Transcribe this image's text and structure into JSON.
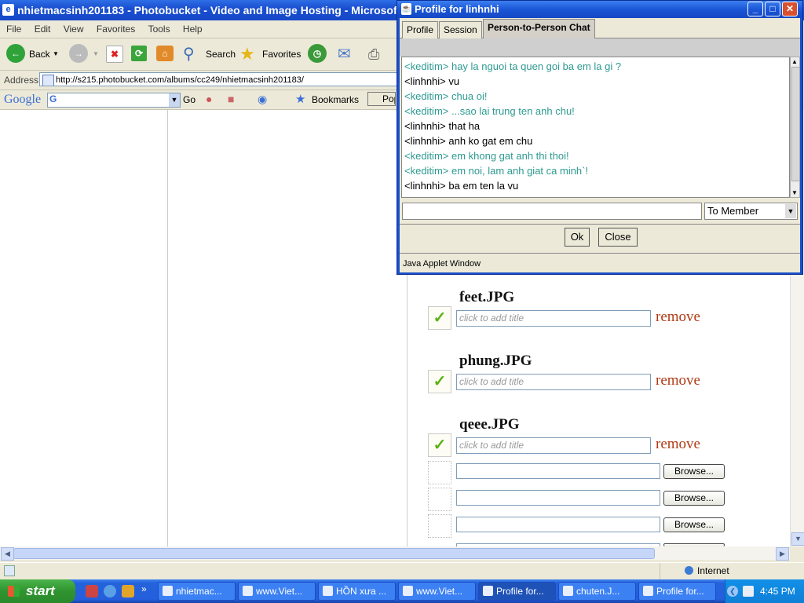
{
  "browser": {
    "title": "nhietmacsinh201183 - Photobucket - Video and Image Hosting - Microsoft Inte",
    "menu": [
      "File",
      "Edit",
      "View",
      "Favorites",
      "Tools",
      "Help"
    ],
    "toolbar": {
      "back": "Back",
      "search": "Search",
      "favorites": "Favorites"
    },
    "address_label": "Address",
    "address_url": "http://s215.photobucket.com/albums/cc249/nhietmacsinh201183/",
    "google": {
      "logo": "Google",
      "go": "Go",
      "bookmarks": "Bookmarks",
      "popups": "Pop"
    },
    "status_zone": "Internet"
  },
  "page": {
    "photos": [
      {
        "filename": "feet.JPG",
        "title_placeholder": "click to add title",
        "remove": "remove"
      },
      {
        "filename": "phung.JPG",
        "title_placeholder": "click to add title",
        "remove": "remove"
      },
      {
        "filename": "qeee.JPG",
        "title_placeholder": "click to add title",
        "remove": "remove"
      }
    ],
    "browse_label": "Browse..."
  },
  "applet": {
    "title": "Profile for linhnhi",
    "tabs": [
      "Profile",
      "Session",
      "Person-to-Person Chat"
    ],
    "active_tab": "Person-to-Person Chat",
    "chat": [
      {
        "speaker": "other",
        "text": "<keditim> hay la nguoi ta quen goi ba em la gi ?"
      },
      {
        "speaker": "self",
        "text": "<linhnhi>  vu"
      },
      {
        "speaker": "other",
        "text": "<keditim> chua oi!"
      },
      {
        "speaker": "other",
        "text": "<keditim> ...sao lai trung ten anh chu!"
      },
      {
        "speaker": "self",
        "text": "<linhnhi>  that ha"
      },
      {
        "speaker": "self",
        "text": "<linhnhi>  anh ko gat em chu"
      },
      {
        "speaker": "other",
        "text": "<keditim> em khong gat anh thi thoi!"
      },
      {
        "speaker": "other",
        "text": "<keditim> em noi, lam anh giat ca minh`!"
      },
      {
        "speaker": "self",
        "text": "<linhnhi>  ba em ten la vu"
      }
    ],
    "recipient": "To Member",
    "ok": "Ok",
    "close": "Close",
    "footer": "Java Applet Window"
  },
  "taskbar": {
    "start": "start",
    "tasks": [
      "nhietmac...",
      "www.Viet...",
      "HỒN xưa ...",
      "www.Viet...",
      "Profile for...",
      "chuten.J...",
      "Profile for..."
    ],
    "active_task": "Profile for...",
    "clock": "4:45 PM"
  },
  "colors": {
    "chat_other": "#2d9a90",
    "remove_link": "#b03a14",
    "check": "#5bb116",
    "xp_blue": "#245edc",
    "start_green": "#2f942f"
  }
}
